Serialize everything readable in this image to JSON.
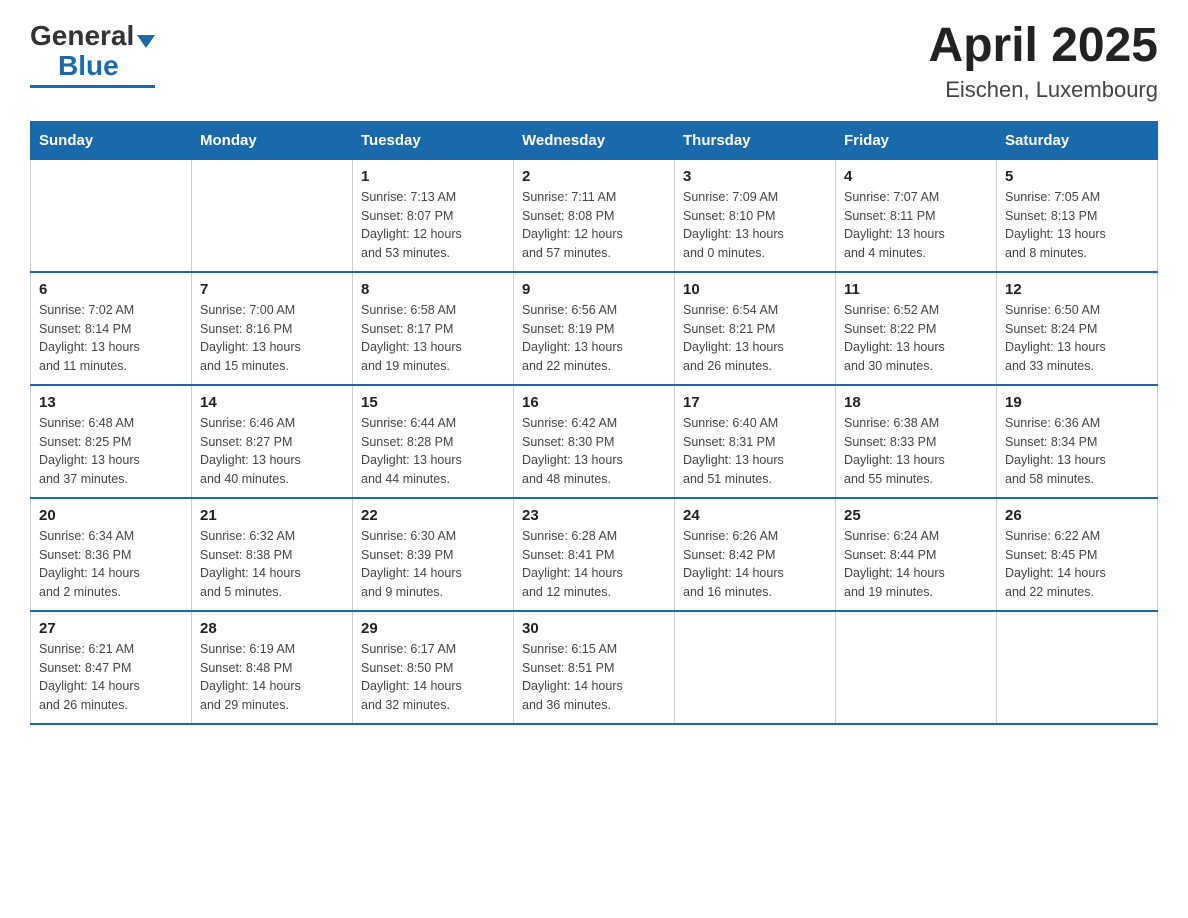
{
  "header": {
    "logo_general": "General",
    "logo_blue": "Blue",
    "title": "April 2025",
    "subtitle": "Eischen, Luxembourg"
  },
  "days_of_week": [
    "Sunday",
    "Monday",
    "Tuesday",
    "Wednesday",
    "Thursday",
    "Friday",
    "Saturday"
  ],
  "weeks": [
    [
      {
        "day": "",
        "info": ""
      },
      {
        "day": "",
        "info": ""
      },
      {
        "day": "1",
        "info": "Sunrise: 7:13 AM\nSunset: 8:07 PM\nDaylight: 12 hours\nand 53 minutes."
      },
      {
        "day": "2",
        "info": "Sunrise: 7:11 AM\nSunset: 8:08 PM\nDaylight: 12 hours\nand 57 minutes."
      },
      {
        "day": "3",
        "info": "Sunrise: 7:09 AM\nSunset: 8:10 PM\nDaylight: 13 hours\nand 0 minutes."
      },
      {
        "day": "4",
        "info": "Sunrise: 7:07 AM\nSunset: 8:11 PM\nDaylight: 13 hours\nand 4 minutes."
      },
      {
        "day": "5",
        "info": "Sunrise: 7:05 AM\nSunset: 8:13 PM\nDaylight: 13 hours\nand 8 minutes."
      }
    ],
    [
      {
        "day": "6",
        "info": "Sunrise: 7:02 AM\nSunset: 8:14 PM\nDaylight: 13 hours\nand 11 minutes."
      },
      {
        "day": "7",
        "info": "Sunrise: 7:00 AM\nSunset: 8:16 PM\nDaylight: 13 hours\nand 15 minutes."
      },
      {
        "day": "8",
        "info": "Sunrise: 6:58 AM\nSunset: 8:17 PM\nDaylight: 13 hours\nand 19 minutes."
      },
      {
        "day": "9",
        "info": "Sunrise: 6:56 AM\nSunset: 8:19 PM\nDaylight: 13 hours\nand 22 minutes."
      },
      {
        "day": "10",
        "info": "Sunrise: 6:54 AM\nSunset: 8:21 PM\nDaylight: 13 hours\nand 26 minutes."
      },
      {
        "day": "11",
        "info": "Sunrise: 6:52 AM\nSunset: 8:22 PM\nDaylight: 13 hours\nand 30 minutes."
      },
      {
        "day": "12",
        "info": "Sunrise: 6:50 AM\nSunset: 8:24 PM\nDaylight: 13 hours\nand 33 minutes."
      }
    ],
    [
      {
        "day": "13",
        "info": "Sunrise: 6:48 AM\nSunset: 8:25 PM\nDaylight: 13 hours\nand 37 minutes."
      },
      {
        "day": "14",
        "info": "Sunrise: 6:46 AM\nSunset: 8:27 PM\nDaylight: 13 hours\nand 40 minutes."
      },
      {
        "day": "15",
        "info": "Sunrise: 6:44 AM\nSunset: 8:28 PM\nDaylight: 13 hours\nand 44 minutes."
      },
      {
        "day": "16",
        "info": "Sunrise: 6:42 AM\nSunset: 8:30 PM\nDaylight: 13 hours\nand 48 minutes."
      },
      {
        "day": "17",
        "info": "Sunrise: 6:40 AM\nSunset: 8:31 PM\nDaylight: 13 hours\nand 51 minutes."
      },
      {
        "day": "18",
        "info": "Sunrise: 6:38 AM\nSunset: 8:33 PM\nDaylight: 13 hours\nand 55 minutes."
      },
      {
        "day": "19",
        "info": "Sunrise: 6:36 AM\nSunset: 8:34 PM\nDaylight: 13 hours\nand 58 minutes."
      }
    ],
    [
      {
        "day": "20",
        "info": "Sunrise: 6:34 AM\nSunset: 8:36 PM\nDaylight: 14 hours\nand 2 minutes."
      },
      {
        "day": "21",
        "info": "Sunrise: 6:32 AM\nSunset: 8:38 PM\nDaylight: 14 hours\nand 5 minutes."
      },
      {
        "day": "22",
        "info": "Sunrise: 6:30 AM\nSunset: 8:39 PM\nDaylight: 14 hours\nand 9 minutes."
      },
      {
        "day": "23",
        "info": "Sunrise: 6:28 AM\nSunset: 8:41 PM\nDaylight: 14 hours\nand 12 minutes."
      },
      {
        "day": "24",
        "info": "Sunrise: 6:26 AM\nSunset: 8:42 PM\nDaylight: 14 hours\nand 16 minutes."
      },
      {
        "day": "25",
        "info": "Sunrise: 6:24 AM\nSunset: 8:44 PM\nDaylight: 14 hours\nand 19 minutes."
      },
      {
        "day": "26",
        "info": "Sunrise: 6:22 AM\nSunset: 8:45 PM\nDaylight: 14 hours\nand 22 minutes."
      }
    ],
    [
      {
        "day": "27",
        "info": "Sunrise: 6:21 AM\nSunset: 8:47 PM\nDaylight: 14 hours\nand 26 minutes."
      },
      {
        "day": "28",
        "info": "Sunrise: 6:19 AM\nSunset: 8:48 PM\nDaylight: 14 hours\nand 29 minutes."
      },
      {
        "day": "29",
        "info": "Sunrise: 6:17 AM\nSunset: 8:50 PM\nDaylight: 14 hours\nand 32 minutes."
      },
      {
        "day": "30",
        "info": "Sunrise: 6:15 AM\nSunset: 8:51 PM\nDaylight: 14 hours\nand 36 minutes."
      },
      {
        "day": "",
        "info": ""
      },
      {
        "day": "",
        "info": ""
      },
      {
        "day": "",
        "info": ""
      }
    ]
  ]
}
